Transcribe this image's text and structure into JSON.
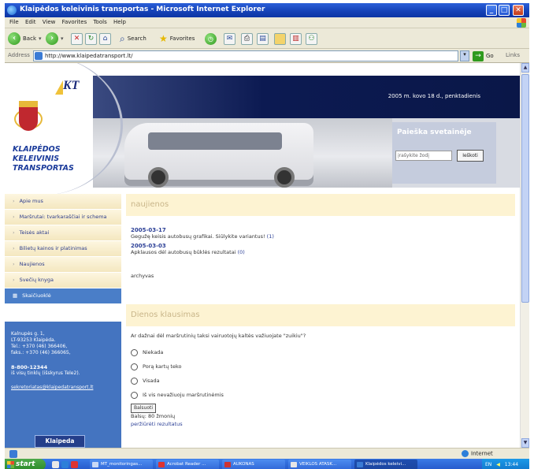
{
  "window": {
    "title": "Klaipėdos keleivinis transportas - Microsoft Internet Explorer",
    "buttons": {
      "minimize": "_",
      "maximize": "□",
      "close": "✕"
    }
  },
  "menu": [
    "File",
    "Edit",
    "View",
    "Favorites",
    "Tools",
    "Help"
  ],
  "toolbar": {
    "back": "Back",
    "search": "Search",
    "favorites": "Favorites"
  },
  "address": {
    "label": "Address",
    "url": "http://www.klaipedatransport.lt/",
    "go": "Go",
    "links": "Links"
  },
  "header": {
    "logo_text": "KT",
    "site_name_lines": [
      "KLAIPĖDOS",
      "KELEIVINIS",
      "TRANSPORTAS"
    ],
    "date": "2005 m. kovo 18 d., penktadienis",
    "search_title": "Paieška svetainėje",
    "search_placeholder": "įrašykite žodį",
    "search_button": "Ieškoti"
  },
  "nav": {
    "items": [
      {
        "label": "Apie mus"
      },
      {
        "label": "Maršrutai: tvarkaraščiai ir schema"
      },
      {
        "label": "Teisės aktai"
      },
      {
        "label": "Bilietų kainos ir platinimas"
      },
      {
        "label": "Naujienos"
      },
      {
        "label": "Svečių knyga"
      },
      {
        "label": "Skaičiuoklė"
      }
    ],
    "contact": {
      "lines": [
        "Kalnupės g. 1,",
        "LT-93253 Klaipėda.",
        "Tel.: +370 (46) 366406,",
        "faks.: +370 (46) 366065,"
      ],
      "phone": "8-800-12344",
      "phone_note": "iš visų tinklų (išskyrus Tele2).",
      "email": "sekretoriatas@klaipedatransport.lt",
      "city_button": "Klaipeda"
    }
  },
  "news": {
    "heading": "naujienos",
    "items": [
      {
        "date": "2005-03-17",
        "text": "Gegužę keisis autobusų grafikai. Siūlykite variantus!",
        "count": "(1)"
      },
      {
        "date": "2005-03-03",
        "text": "Apklausos dėl autobusų būklės rezultatai",
        "count": "(0)"
      }
    ],
    "archive": "archyvas"
  },
  "poll": {
    "heading": "Dienos klausimas",
    "question": "Ar dažnai dėl maršrutinių taksi vairuotojų kaltės važiuojate \"zuikiu\"?",
    "options": [
      "Niekada",
      "Porą kartų teko",
      "Visada",
      "Iš vis nevažiuoju maršrutinėmis"
    ],
    "vote_button": "Balsuoti",
    "votes_text": "Balsų: 80 žmonių",
    "results_link": "peržiūrėti rezultatus"
  },
  "status": {
    "zone": "Internet"
  },
  "taskbar": {
    "start": "start",
    "tasks": [
      {
        "label": "MT_monitoringas...",
        "color": "#c9d9f5"
      },
      {
        "label": "Acrobat Reader ...",
        "color": "#d33"
      },
      {
        "label": "AUKONAS",
        "color": "#c33"
      },
      {
        "label": "VEIKLOS ATASK...",
        "color": "#e6e6e6"
      },
      {
        "label": "Klaipėdos keleivi...",
        "color": "#3a7bd5"
      }
    ],
    "lang": "EN",
    "clock": "13:44"
  }
}
